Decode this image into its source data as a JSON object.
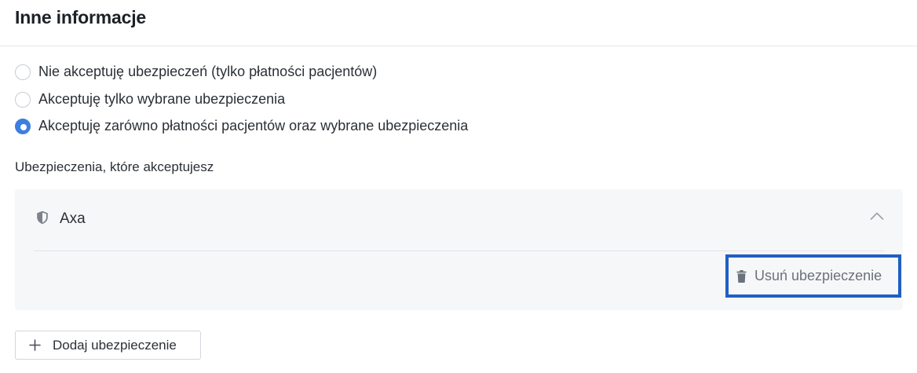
{
  "header": {
    "title": "Inne informacje"
  },
  "acceptance": {
    "options": [
      {
        "label": "Nie akceptuję ubezpieczeń (tylko płatności pacjentów)",
        "checked": false
      },
      {
        "label": "Akceptuję tylko wybrane ubezpieczenia",
        "checked": false
      },
      {
        "label": "Akceptuję zarówno płatności pacjentów oraz wybrane ubezpieczenia",
        "checked": true
      }
    ]
  },
  "insurances": {
    "section_label": "Ubezpieczenia, które akceptujesz",
    "items": [
      {
        "name": "Axa",
        "icon": "shield-icon",
        "expanded": true,
        "remove_label": "Usuń ubezpieczenie"
      }
    ],
    "add_label": "Dodaj ubezpieczenie"
  },
  "colors": {
    "accent": "#3d7fe0",
    "highlight_border": "#1f5fc2",
    "card_background": "#f6f7f9"
  }
}
